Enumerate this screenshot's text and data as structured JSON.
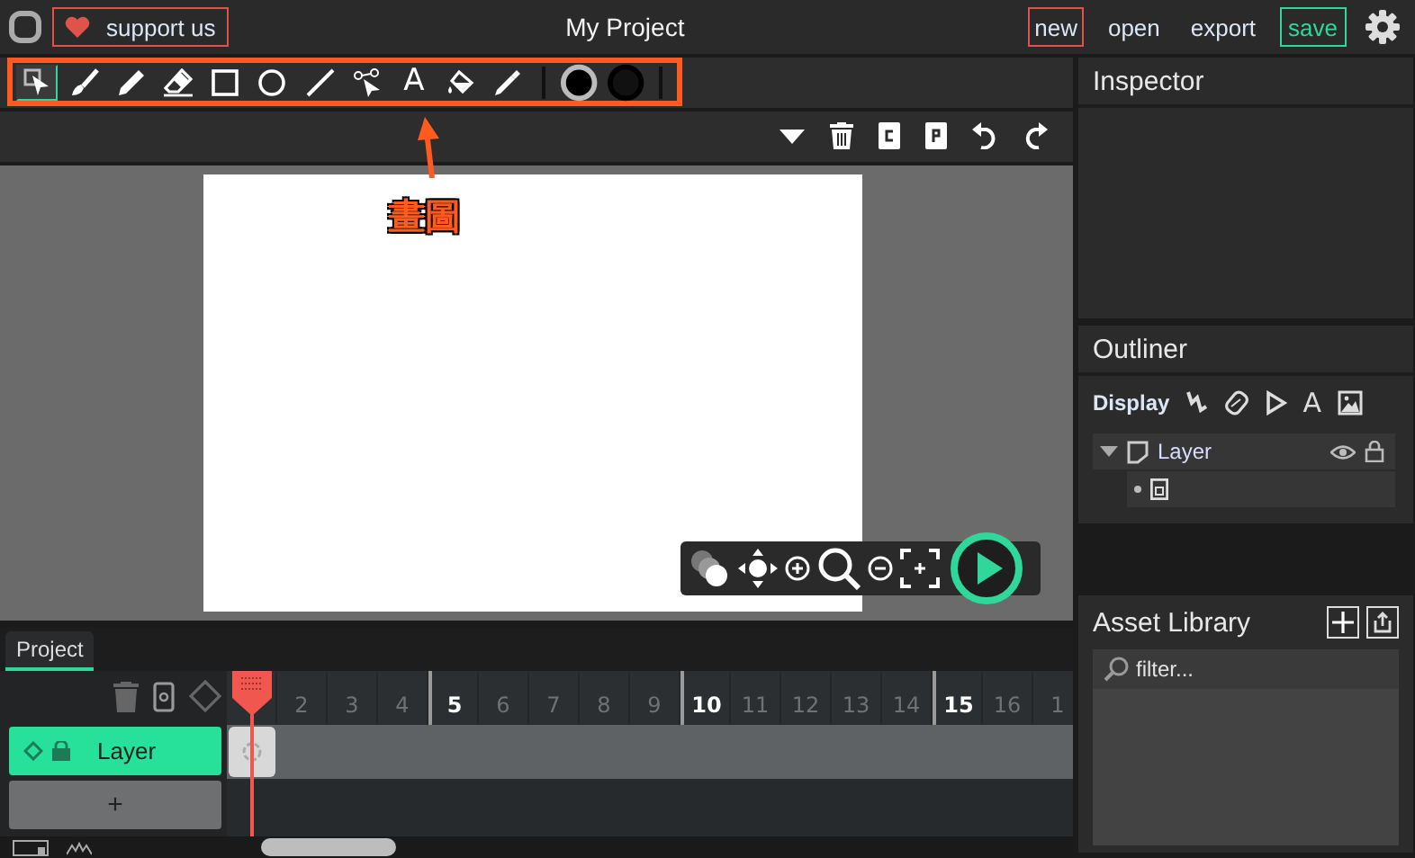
{
  "app_bar": {
    "support_label": "support us",
    "title": "My Project",
    "menu": [
      {
        "label": "new",
        "kind": "new"
      },
      {
        "label": "open",
        "kind": "plain"
      },
      {
        "label": "export",
        "kind": "plain"
      },
      {
        "label": "save",
        "kind": "save"
      }
    ]
  },
  "tools": [
    {
      "kind": "select",
      "selected": true
    },
    {
      "kind": "brush",
      "selected": false
    },
    {
      "kind": "pencil",
      "selected": false
    },
    {
      "kind": "eraser",
      "selected": false
    },
    {
      "kind": "rectangle",
      "selected": false
    },
    {
      "kind": "ellipse",
      "selected": false
    },
    {
      "kind": "line",
      "selected": false
    },
    {
      "kind": "path",
      "selected": false
    },
    {
      "kind": "text",
      "glyph": "A",
      "selected": false
    },
    {
      "kind": "fill",
      "selected": false
    },
    {
      "kind": "eyedropper",
      "selected": false
    }
  ],
  "annotation": {
    "label": "畫圖"
  },
  "inspector": {
    "title": "Inspector"
  },
  "outliner": {
    "title": "Outliner",
    "mode": "Display",
    "text_glyph": "A",
    "tree": [
      {
        "label": "Layer",
        "expanded": true,
        "children": [
          {
            "kind": "frame"
          }
        ]
      }
    ]
  },
  "asset_library": {
    "title": "Asset Library",
    "search": {
      "placeholder": "filter..."
    }
  },
  "timeline": {
    "tab": {
      "label": "Project",
      "selected": true
    },
    "frames": [
      {
        "major": false
      },
      {
        "label": "2",
        "major": false
      },
      {
        "label": "3",
        "major": false
      },
      {
        "label": "4",
        "major": false
      },
      {
        "label": "5",
        "major": true
      },
      {
        "label": "6",
        "major": false
      },
      {
        "label": "7",
        "major": false
      },
      {
        "label": "8",
        "major": false
      },
      {
        "label": "9",
        "major": false
      },
      {
        "label": "10",
        "major": true
      },
      {
        "label": "11",
        "major": false
      },
      {
        "label": "12",
        "major": false
      },
      {
        "label": "13",
        "major": false
      },
      {
        "label": "14",
        "major": false
      },
      {
        "label": "15",
        "major": true
      },
      {
        "label": "16",
        "major": false
      },
      {
        "label": "1",
        "major": false
      }
    ],
    "layers": [
      {
        "name": "Layer",
        "selected": true
      }
    ],
    "add_label": "+"
  }
}
